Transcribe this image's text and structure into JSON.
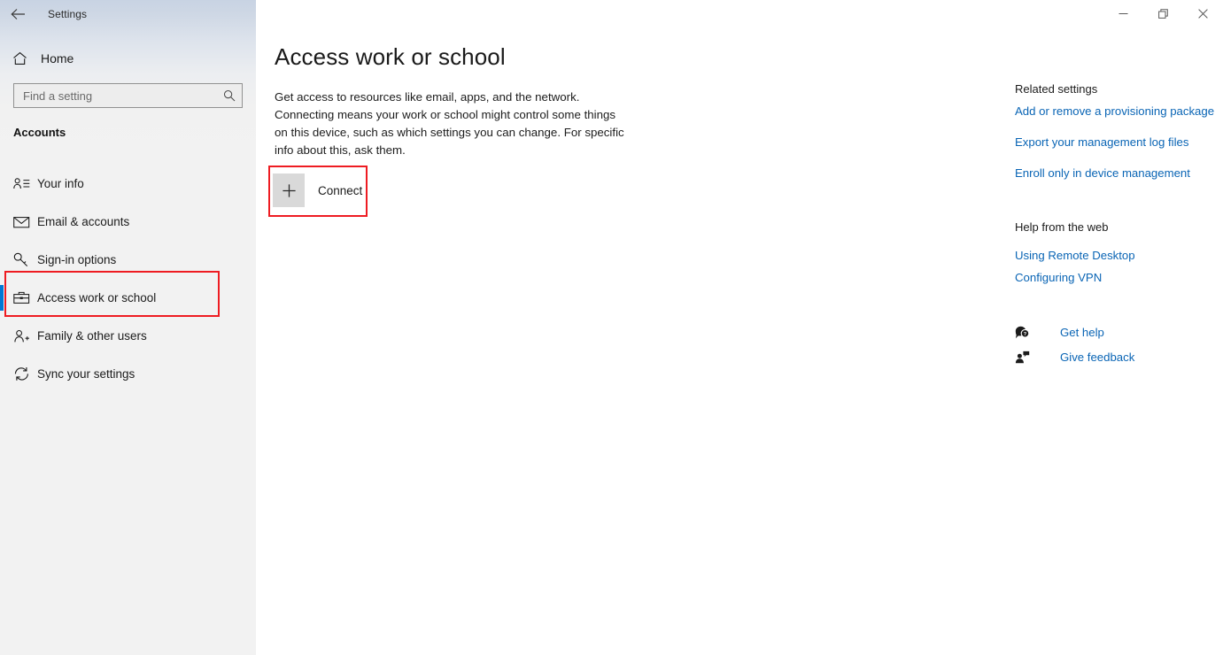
{
  "window": {
    "app_title": "Settings",
    "back_icon": "back-arrow-icon",
    "controls": {
      "minimize_label": "Minimize",
      "restore_label": "Restore",
      "close_label": "Close"
    }
  },
  "sidebar": {
    "home": {
      "label": "Home",
      "icon": "home-icon"
    },
    "search": {
      "placeholder": "Find a setting",
      "value": "",
      "icon": "search-icon"
    },
    "section_label": "Accounts",
    "items": [
      {
        "label": "Your info",
        "icon": "contact-card-icon",
        "selected": false
      },
      {
        "label": "Email & accounts",
        "icon": "envelope-icon",
        "selected": false
      },
      {
        "label": "Sign-in options",
        "icon": "key-icon",
        "selected": false
      },
      {
        "label": "Access work or school",
        "icon": "briefcase-icon",
        "selected": true
      },
      {
        "label": "Family & other users",
        "icon": "person-add-icon",
        "selected": false
      },
      {
        "label": "Sync your settings",
        "icon": "sync-icon",
        "selected": false
      }
    ]
  },
  "main": {
    "title": "Access work or school",
    "description": "Get access to resources like email, apps, and the network. Connecting means your work or school might control some things on this device, such as which settings you can change. For specific info about this, ask them.",
    "connect_button": {
      "label": "Connect",
      "icon": "plus-icon"
    }
  },
  "right_panel": {
    "related_settings": {
      "heading": "Related settings",
      "links": [
        "Add or remove a provisioning package",
        "Export your management log files",
        "Enroll only in device management"
      ]
    },
    "help_from_web": {
      "heading": "Help from the web",
      "links": [
        "Using Remote Desktop",
        "Configuring VPN"
      ]
    },
    "support": [
      {
        "label": "Get help",
        "icon": "help-bubble-icon"
      },
      {
        "label": "Give feedback",
        "icon": "feedback-person-icon"
      }
    ]
  },
  "annotations": {
    "accent_red": "#ee1c22",
    "selection_blue": "#0078d4",
    "link_blue": "#0a65b5"
  }
}
